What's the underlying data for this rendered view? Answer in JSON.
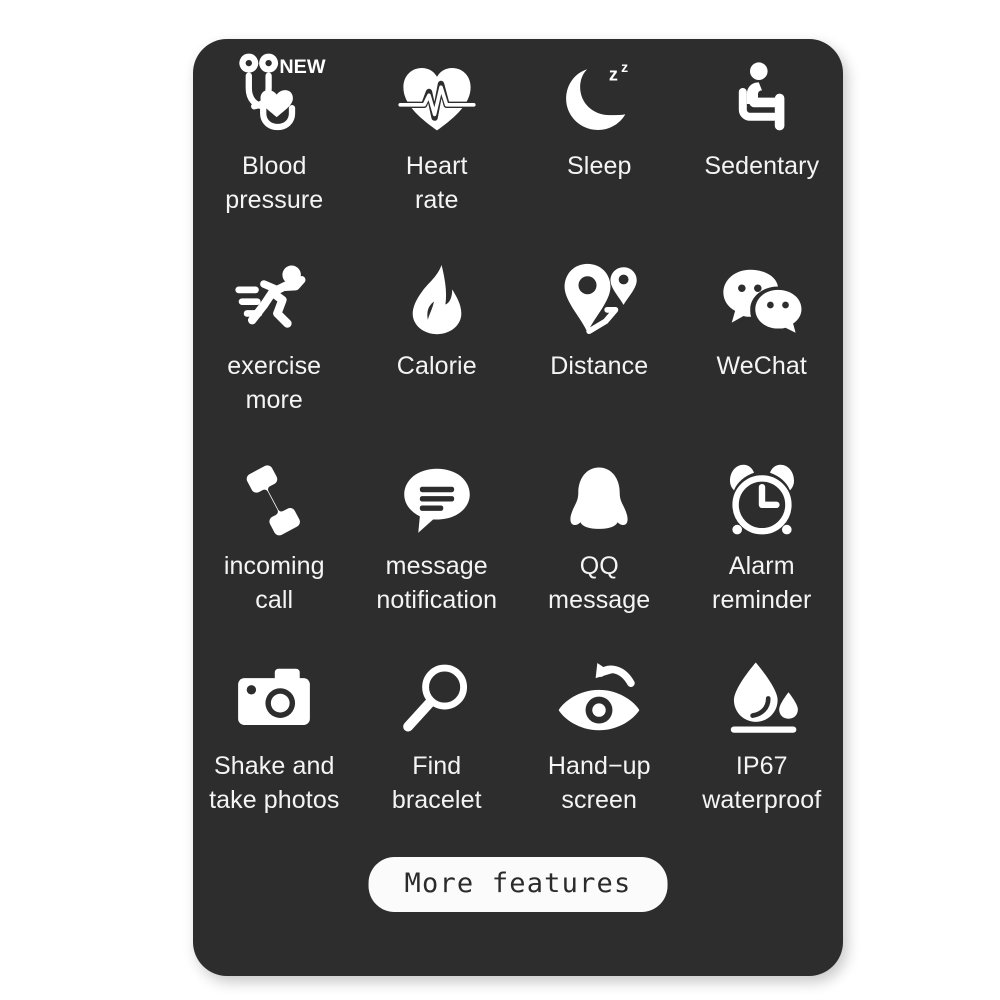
{
  "card": {
    "background_color": "#2d2d2d",
    "foreground_color": "#f4f4f4",
    "page_background_color": "#ffffff"
  },
  "features": [
    {
      "label": "Blood\npressure",
      "icon": "stethoscope-heart-icon",
      "badge": "NEW",
      "name": "blood-pressure"
    },
    {
      "label": "Heart\nrate",
      "icon": "heart-pulse-icon",
      "badge": "",
      "name": "heart-rate"
    },
    {
      "label": "Sleep",
      "icon": "moon-zzz-icon",
      "badge": "",
      "name": "sleep"
    },
    {
      "label": "Sedentary",
      "icon": "sitting-person-icon",
      "badge": "",
      "name": "sedentary"
    },
    {
      "label": "exercise\nmore",
      "icon": "running-person-icon",
      "badge": "",
      "name": "exercise-more"
    },
    {
      "label": "Calorie",
      "icon": "flame-icon",
      "badge": "",
      "name": "calorie"
    },
    {
      "label": "Distance",
      "icon": "map-pin-route-icon",
      "badge": "",
      "name": "distance"
    },
    {
      "label": "WeChat",
      "icon": "wechat-bubbles-icon",
      "badge": "",
      "name": "wechat"
    },
    {
      "label": "incoming\ncall",
      "icon": "phone-handset-icon",
      "badge": "",
      "name": "incoming-call"
    },
    {
      "label": "message\nnotification",
      "icon": "speech-bubble-lines-icon",
      "badge": "",
      "name": "message-notification"
    },
    {
      "label": "QQ\nmessage",
      "icon": "qq-penguin-icon",
      "badge": "",
      "name": "qq-message"
    },
    {
      "label": "Alarm\nreminder",
      "icon": "alarm-clock-icon",
      "badge": "",
      "name": "alarm-reminder"
    },
    {
      "label": "Shake and\ntake photos",
      "icon": "camera-icon",
      "badge": "",
      "name": "shake-and-take-photos"
    },
    {
      "label": "Find\nbracelet",
      "icon": "magnifier-icon",
      "badge": "",
      "name": "find-bracelet"
    },
    {
      "label": "Hand−up\nscreen",
      "icon": "eye-arrow-icon",
      "badge": "",
      "name": "hand-up-screen"
    },
    {
      "label": "IP67\nwaterproof",
      "icon": "water-drop-icon",
      "badge": "",
      "name": "ip67-waterproof"
    }
  ],
  "footer": {
    "more_features_label": "More features"
  }
}
